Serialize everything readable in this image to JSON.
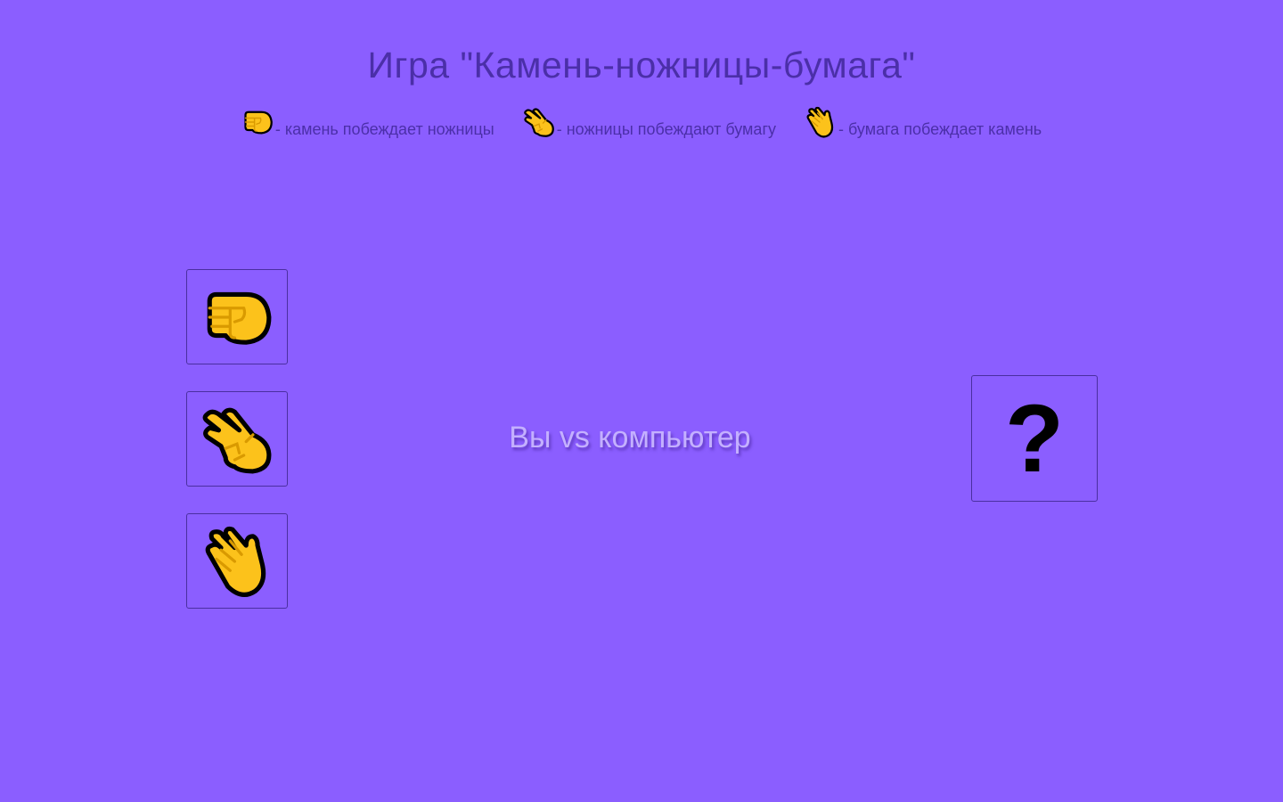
{
  "game": {
    "title": "Игра \"Камень-ножницы-бумага\""
  },
  "rules": [
    {
      "icon": "fist-icon",
      "text": "- камень побеждает ножницы"
    },
    {
      "icon": "scissors-hand-icon",
      "text": "- ножницы побеждают бумагу"
    },
    {
      "icon": "paper-hand-icon",
      "text": "- бумага побеждает камень"
    }
  ],
  "choices": [
    {
      "name": "rock",
      "icon": "fist-icon"
    },
    {
      "name": "scissors",
      "icon": "scissors-hand-icon"
    },
    {
      "name": "paper",
      "icon": "paper-hand-icon"
    }
  ],
  "versus_text": "Вы vs компьютер",
  "computer_choice": "?",
  "colors": {
    "background": "#8b5eff",
    "title": "#4b2fa8",
    "versus": "#c4b0ff",
    "hand": "#fcc21b",
    "outline": "#000000"
  }
}
